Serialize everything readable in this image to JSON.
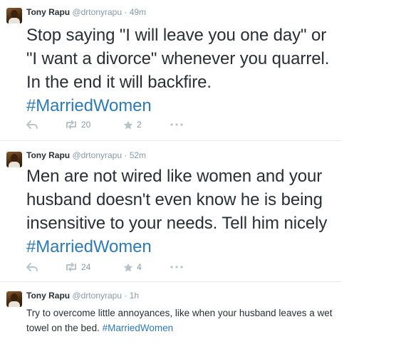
{
  "tweets": [
    {
      "name": "Tony Rapu",
      "handle": "@drtonyrapu",
      "separator": "·",
      "time": "49m",
      "text_before": "Stop saying \"I will leave you one day\" or \"I want a divorce\" whenever you quarrel. In the end it will backfire.",
      "hashtag": "#MarriedWomen",
      "retweets": "20",
      "favorites": "2"
    },
    {
      "name": "Tony Rapu",
      "handle": "@drtonyrapu",
      "separator": "·",
      "time": "52m",
      "text_before": "Men are not wired like women and your husband doesn't even know he is being insensitive to your needs. Tell him nicely",
      "hashtag": "#MarriedWomen",
      "retweets": "24",
      "favorites": "4"
    },
    {
      "name": "Tony Rapu",
      "handle": "@drtonyrapu",
      "separator": "·",
      "time": "1h",
      "text_before": "Try to overcome little annoyances, like when your husband leaves a wet towel on the bed.",
      "hashtag": "#MarriedWomen"
    }
  ],
  "colors": {
    "hashtag": "#2b7bb9",
    "meta": "#8899a6",
    "text": "#292f33"
  },
  "icons": {
    "reply": "reply-icon",
    "retweet": "retweet-icon",
    "favorite": "star-icon",
    "more": "more-icon"
  }
}
